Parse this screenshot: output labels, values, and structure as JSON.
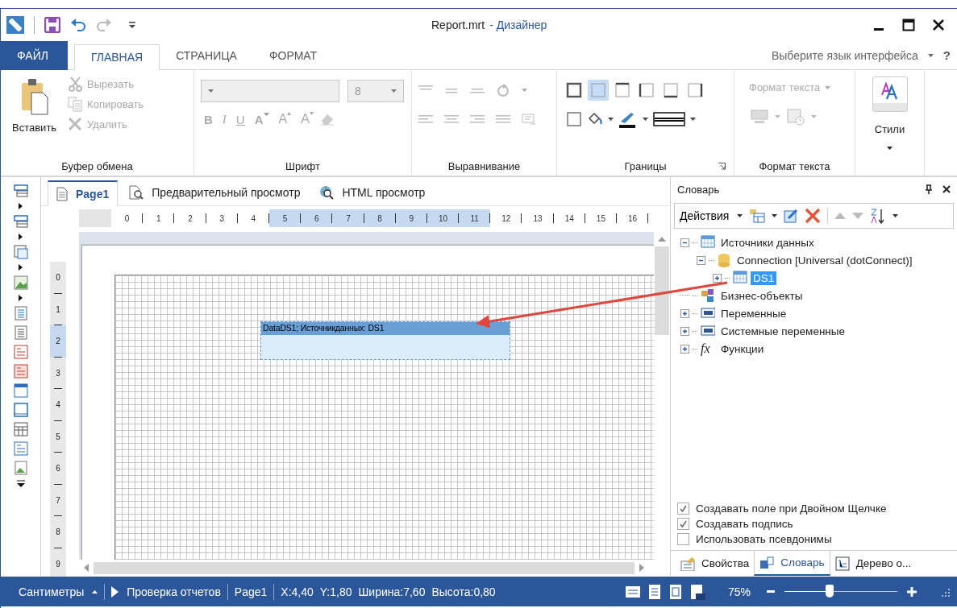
{
  "window": {
    "title": "Report.mrt",
    "app_name": "- Дизайнер"
  },
  "ribbon": {
    "tabs": [
      {
        "label": "ФАЙЛ",
        "kind": "file",
        "selected": false
      },
      {
        "label": "ГЛАВНАЯ",
        "kind": "tab",
        "selected": true
      },
      {
        "label": "СТРАНИЦА",
        "kind": "tab",
        "selected": false
      },
      {
        "label": "ФОРМАТ",
        "kind": "tab",
        "selected": false
      }
    ],
    "language_selector": "Выберите язык интерфейса",
    "help": "?",
    "clipboard": {
      "label": "Буфер обмена",
      "paste": "Вставить",
      "actions": [
        {
          "label": "Вырезать",
          "kind": "cut",
          "disabled": true
        },
        {
          "label": "Копировать",
          "kind": "copy",
          "disabled": true
        },
        {
          "label": "Удалить",
          "kind": "delete",
          "disabled": true
        }
      ]
    },
    "font": {
      "label": "Шрифт",
      "font_size": "8",
      "disabled": true,
      "buttons": [
        {
          "label": "B",
          "kind": "bold"
        },
        {
          "label": "I",
          "kind": "italic"
        },
        {
          "label": "U",
          "kind": "underline"
        },
        {
          "label": "A",
          "kind": "color"
        },
        {
          "label": "A",
          "kind": "grow"
        },
        {
          "label": "A",
          "kind": "shrink"
        }
      ]
    },
    "alignment": {
      "label": "Выравнивание",
      "disabled": true
    },
    "borders": {
      "label": "Границы",
      "sides": [
        {
          "kind": "all",
          "selected": false
        },
        {
          "kind": "none",
          "selected": true
        },
        {
          "kind": "top",
          "selected": false
        },
        {
          "kind": "left",
          "selected": false
        },
        {
          "kind": "bottom",
          "selected": false
        },
        {
          "kind": "right",
          "selected": false
        }
      ]
    },
    "text_format": {
      "label": "Формат текста",
      "button": "Формат текста",
      "disabled": true
    },
    "styles": {
      "label": "Стили"
    }
  },
  "designer": {
    "tabs": [
      {
        "label": "Page1",
        "kind": "page",
        "selected": true
      },
      {
        "label": "Предварительный просмотр",
        "kind": "preview",
        "selected": false
      },
      {
        "label": "HTML просмотр",
        "kind": "html",
        "selected": false
      }
    ],
    "h_ruler": [
      {
        "label": "0",
        "highlighted": false
      },
      {
        "label": "1",
        "highlighted": false
      },
      {
        "label": "2",
        "highlighted": false
      },
      {
        "label": "3",
        "highlighted": false
      },
      {
        "label": "4",
        "highlighted": false
      },
      {
        "label": "5",
        "highlighted": true
      },
      {
        "label": "6",
        "highlighted": true
      },
      {
        "label": "7",
        "highlighted": true
      },
      {
        "label": "8",
        "highlighted": true
      },
      {
        "label": "9",
        "highlighted": true
      },
      {
        "label": "10",
        "highlighted": true
      },
      {
        "label": "11",
        "highlighted": true
      },
      {
        "label": "12",
        "highlighted": false
      },
      {
        "label": "13",
        "highlighted": false
      },
      {
        "label": "14",
        "highlighted": false
      },
      {
        "label": "15",
        "highlighted": false
      },
      {
        "label": "16",
        "highlighted": false
      }
    ],
    "v_ruler": [
      {
        "label": "0",
        "highlighted": false
      },
      {
        "label": "1",
        "highlighted": false
      },
      {
        "label": "2",
        "highlighted": true
      },
      {
        "label": "3",
        "highlighted": false
      },
      {
        "label": "4",
        "highlighted": false
      },
      {
        "label": "5",
        "highlighted": false
      },
      {
        "label": "6",
        "highlighted": false
      },
      {
        "label": "7",
        "highlighted": false
      },
      {
        "label": "8",
        "highlighted": false
      },
      {
        "label": "9",
        "highlighted": false
      }
    ],
    "band": {
      "title": "DataDS1; Источникданных: DS1"
    }
  },
  "dictionary": {
    "title": "Словарь",
    "actions": "Действия",
    "tree": [
      {
        "label": "Источники данных",
        "kind": "datasources",
        "expanded": true,
        "selected": false,
        "children": [
          {
            "label": "Connection [Universal (dotConnect)]",
            "kind": "connection",
            "expanded": true,
            "selected": false,
            "children": [
              {
                "label": "DS1",
                "kind": "table",
                "expanded": false,
                "selected": true
              }
            ]
          }
        ]
      },
      {
        "label": "Бизнес-объекты",
        "kind": "business",
        "selected": false
      },
      {
        "label": "Переменные",
        "kind": "variables",
        "expanded": false,
        "selected": false
      },
      {
        "label": "Системные переменные",
        "kind": "system",
        "expanded": false,
        "selected": false
      },
      {
        "label": "Функции",
        "kind": "functions",
        "icon_text": "fx",
        "expanded": false,
        "selected": false
      }
    ],
    "options": [
      {
        "label": "Создавать поле при Двойном Щелчке",
        "checked": true
      },
      {
        "label": "Создавать подпись",
        "checked": true
      },
      {
        "label": "Использовать псевдонимы",
        "checked": false
      }
    ],
    "tabs": [
      {
        "label": "Свойства",
        "kind": "properties",
        "selected": false
      },
      {
        "label": "Словарь",
        "kind": "dictionary",
        "selected": true
      },
      {
        "label": "Дерево о...",
        "kind": "tree",
        "selected": false
      }
    ]
  },
  "status_bar": {
    "units": "Сантиметры",
    "check": "Проверка отчетов",
    "page": "Page1",
    "x": "X:4,40",
    "y": "Y:1,80",
    "width": "Ширина:7,60",
    "height": "Высота:0,80",
    "zoom": "75%",
    "zoom_slider": {
      "level": 0.4
    }
  }
}
